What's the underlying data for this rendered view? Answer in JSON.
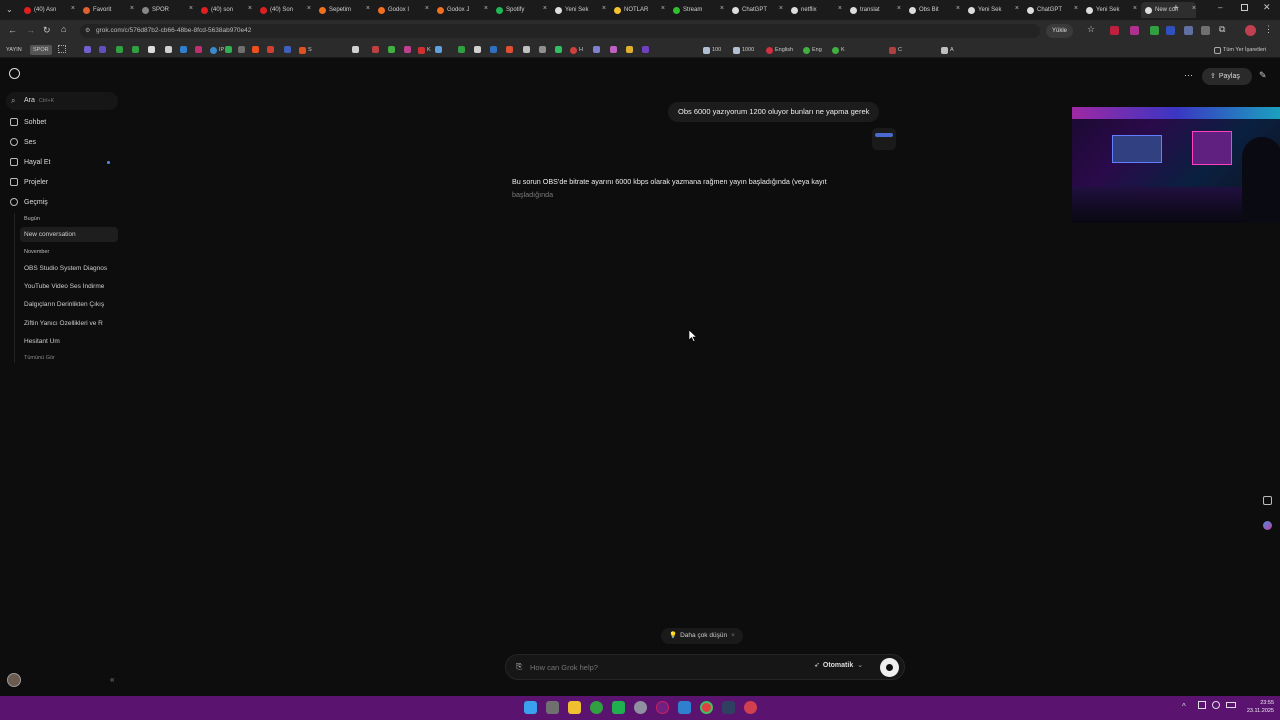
{
  "tabs": [
    {
      "label": "(40) Asn",
      "color": "#e02020"
    },
    {
      "label": "Favorit",
      "color": "#e06030"
    },
    {
      "label": "SPOR",
      "color": "#888888"
    },
    {
      "label": "(40) son",
      "color": "#e02020"
    },
    {
      "label": "(40) Son",
      "color": "#e02020"
    },
    {
      "label": "Sepetim",
      "color": "#f07020"
    },
    {
      "label": "Godox I",
      "color": "#f07020"
    },
    {
      "label": "Godox J",
      "color": "#f07020"
    },
    {
      "label": "Spotify",
      "color": "#1db954"
    },
    {
      "label": "Yeni Sek",
      "color": "#dddddd"
    },
    {
      "label": "NOTLAR",
      "color": "#f4c430"
    },
    {
      "label": "Stream",
      "color": "#30c030"
    },
    {
      "label": "ChatGPT",
      "color": "#dddddd"
    },
    {
      "label": "netflix",
      "color": "#dddddd"
    },
    {
      "label": "translat",
      "color": "#dddddd"
    },
    {
      "label": "Obs Bit",
      "color": "#dddddd"
    },
    {
      "label": "Yeni Sek",
      "color": "#dddddd"
    },
    {
      "label": "ChatGPT",
      "color": "#dddddd"
    },
    {
      "label": "Yeni Sek",
      "color": "#dddddd"
    },
    {
      "label": "New con",
      "color": "#dddddd"
    }
  ],
  "address": {
    "url": "grok.com/c/576d87b2-cb66-48be-8fcd-5638ab970e42",
    "update_label": "Yükle"
  },
  "bookmarks": {
    "items": [
      "YAYIN",
      "SPOR",
      "IP",
      "S",
      "K",
      "H",
      "100",
      "1000",
      "English",
      "Eng",
      "K",
      "C",
      "A"
    ],
    "all_label": "Tüm Yer İşaretleri"
  },
  "sidebar": {
    "search": {
      "label": "Ara",
      "shortcut": "Ctrl+K"
    },
    "nav": [
      {
        "label": "Sohbet"
      },
      {
        "label": "Ses"
      },
      {
        "label": "Hayal Et"
      },
      {
        "label": "Projeler"
      },
      {
        "label": "Geçmiş"
      }
    ],
    "section_today": "Bugün",
    "today": [
      "New conversation"
    ],
    "section_november": "November",
    "november": [
      "OBS Studio System Diagnos",
      "YouTube Video Ses İndirme",
      "Dalgıçların Derinlikten Çıkış",
      "Ziftin Yanıcı Özellikleri ve R",
      "Hesitant Um"
    ],
    "see_all": "Tümünü Gör"
  },
  "header": {
    "share_label": "Paylaş"
  },
  "chat": {
    "user_message": "Obs 6000 yazıyorum 1200 oluyor bunları ne yapma gerek",
    "assistant_line1": "Bu sorun OBS'de bitrate ayarını 6000 kbps olarak yazmana rağmen yayın başladığında (veya kayıt",
    "assistant_line2": "başladığında"
  },
  "composer": {
    "think_label": "Daha çok düşün",
    "placeholder": "How can Grok help?",
    "mode_label": "Otomatik"
  },
  "clock": {
    "time": "23:55",
    "date": "23.11.2025"
  },
  "colors": {
    "taskbar": "#5a1470",
    "background": "#0d0d0d"
  }
}
